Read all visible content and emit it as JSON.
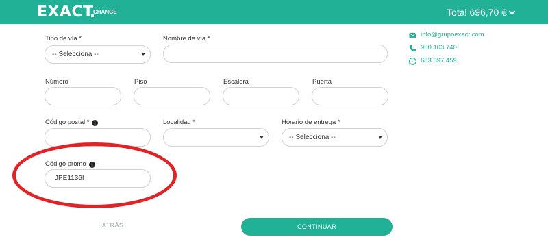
{
  "header": {
    "logo_text": "EXACT",
    "logo_subtext": "CHANGE",
    "total_label": "Total 696,70 €",
    "brand_color": "#20b196"
  },
  "form": {
    "tipo_via": {
      "label": "Tipo de vía *",
      "selected": "-- Selecciona --"
    },
    "nombre_via": {
      "label": "Nombre de vía *",
      "value": ""
    },
    "numero": {
      "label": "Número",
      "value": ""
    },
    "piso": {
      "label": "Piso",
      "value": ""
    },
    "escalera": {
      "label": "Escalera",
      "value": ""
    },
    "puerta": {
      "label": "Puerta",
      "value": ""
    },
    "codigo_postal": {
      "label": "Código postal *",
      "value": ""
    },
    "localidad": {
      "label": "Localidad *",
      "selected": ""
    },
    "horario": {
      "label": "Horario de entrega *",
      "selected": "-- Selecciona --"
    },
    "codigo_promo": {
      "label": "Código promo",
      "value": "JPE1136I"
    }
  },
  "contact": {
    "email": "info@grupoexact.com",
    "phone": "900 103 740",
    "whatsapp": "683 597 459"
  },
  "actions": {
    "back_label": "ATRÁS",
    "continue_label": "CONTINUAR"
  },
  "annotation_color": "#e42124"
}
